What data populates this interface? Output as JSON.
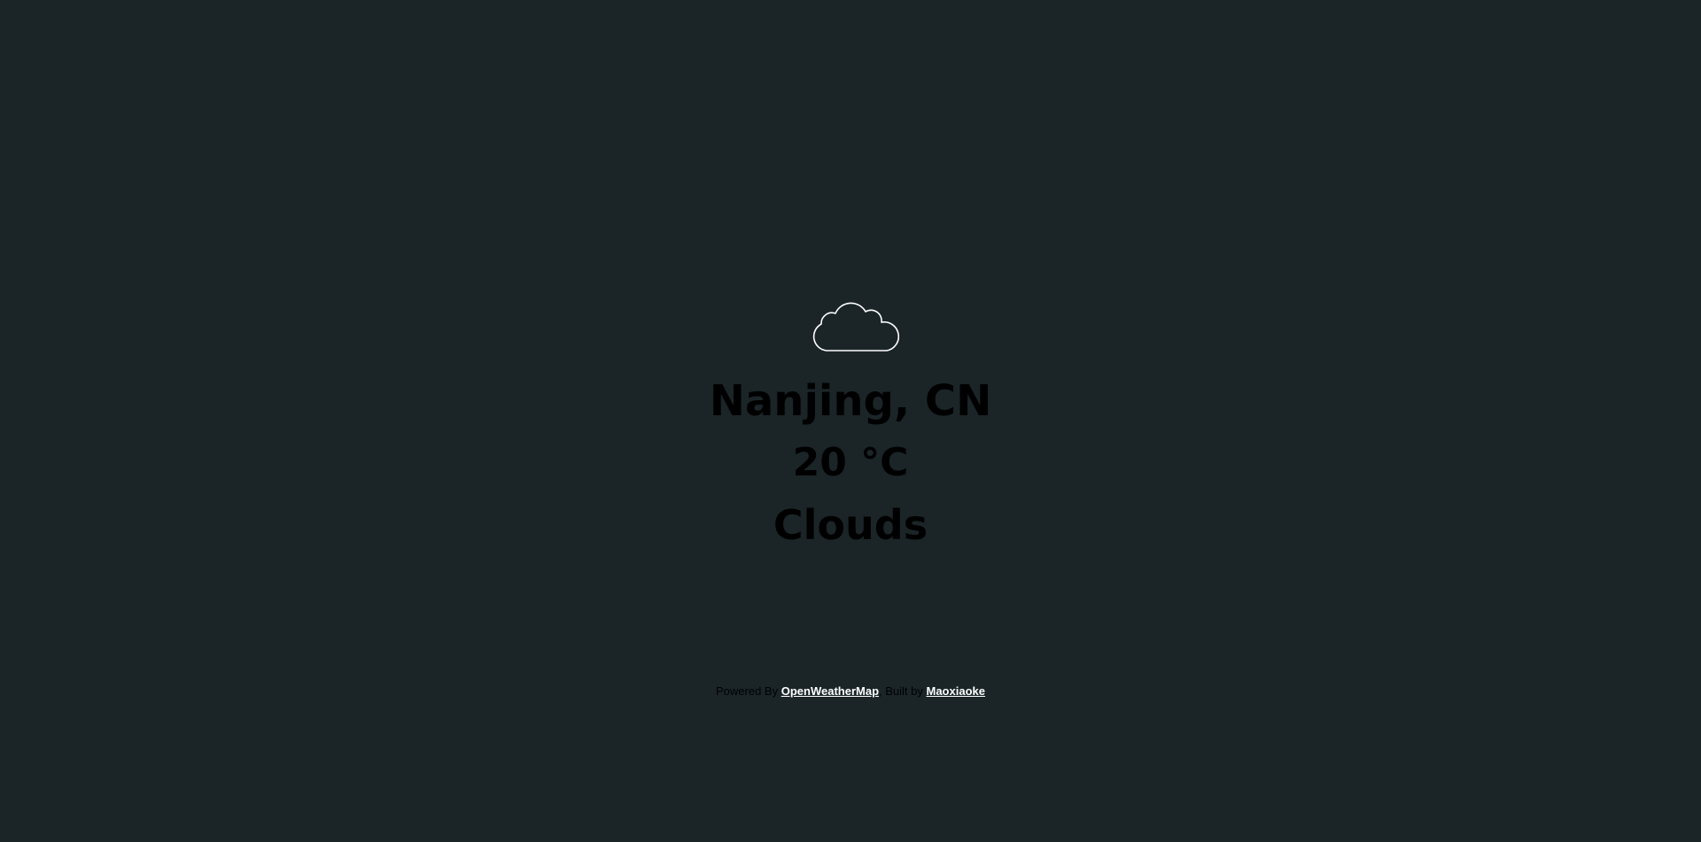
{
  "weather": {
    "icon": "cloud-icon",
    "city": "Nanjing, CN",
    "temperature": "20 °C",
    "description": "Clouds"
  },
  "footer": {
    "powered_by_text": "Powered By",
    "provider_link": "OpenWeatherMap",
    "separator_text": ", Built by",
    "author_link": "Maoxiaoke"
  },
  "colors": {
    "background": "#1b2528",
    "text": "#000000",
    "link": "#ffffff",
    "icon_stroke": "#ffffff"
  }
}
